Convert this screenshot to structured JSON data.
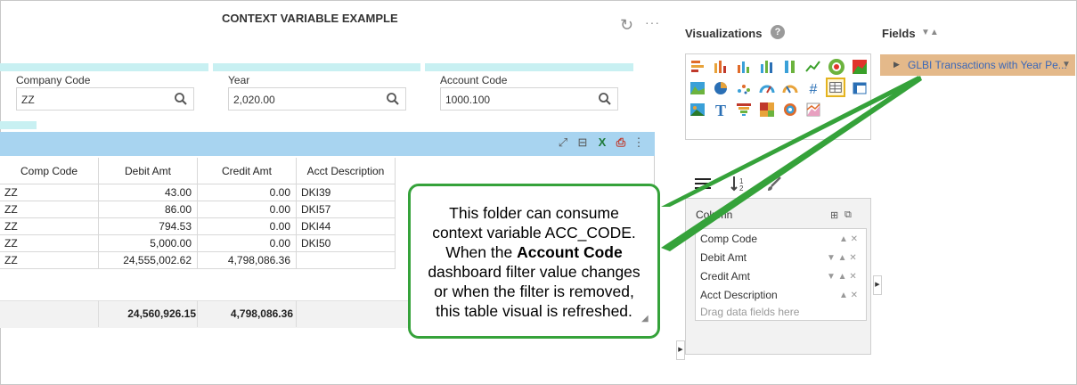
{
  "header": {
    "title": "CONTEXT VARIABLE EXAMPLE"
  },
  "filters": [
    {
      "label": "Company Code",
      "value": "ZZ"
    },
    {
      "label": "Year",
      "value": "2,020.00"
    },
    {
      "label": "Account Code",
      "value": "1000.100"
    }
  ],
  "table": {
    "columns": [
      "Comp Code",
      "Debit Amt",
      "Credit Amt",
      "Acct Description"
    ],
    "rows": [
      [
        "ZZ",
        "43.00",
        "0.00",
        "DKI39"
      ],
      [
        "ZZ",
        "86.00",
        "0.00",
        "DKI57"
      ],
      [
        "ZZ",
        "794.53",
        "0.00",
        "DKI44"
      ],
      [
        "ZZ",
        "5,000.00",
        "0.00",
        "DKI50"
      ],
      [
        "ZZ",
        "24,555,002.62",
        "4,798,086.36",
        ""
      ]
    ],
    "totals": {
      "debit": "24,560,926.15",
      "credit": "4,798,086.36"
    }
  },
  "visualizations": {
    "title": "Visualizations",
    "help": "?"
  },
  "fields": {
    "title": "Fields",
    "item": "GLBI Transactions with Year Pe..."
  },
  "properties": {
    "column_label": "Column",
    "columns": [
      "Comp Code",
      "Debit Amt",
      "Credit Amt",
      "Acct Description"
    ],
    "drag_hint": "Drag data fields here"
  },
  "callout": {
    "line1": "This folder can consume",
    "line2": "context variable ACC_CODE.",
    "line3a": "When the ",
    "line3b": "Account Code",
    "line4": "dashboard filter value changes",
    "line5": "or when the filter is removed,",
    "line6": "this table visual is refreshed."
  },
  "colors": {
    "accent_green": "#35a23a",
    "header_blue": "#a8d4f0",
    "filter_cyan": "#c8f0f2",
    "field_orange": "#e4b98a"
  }
}
